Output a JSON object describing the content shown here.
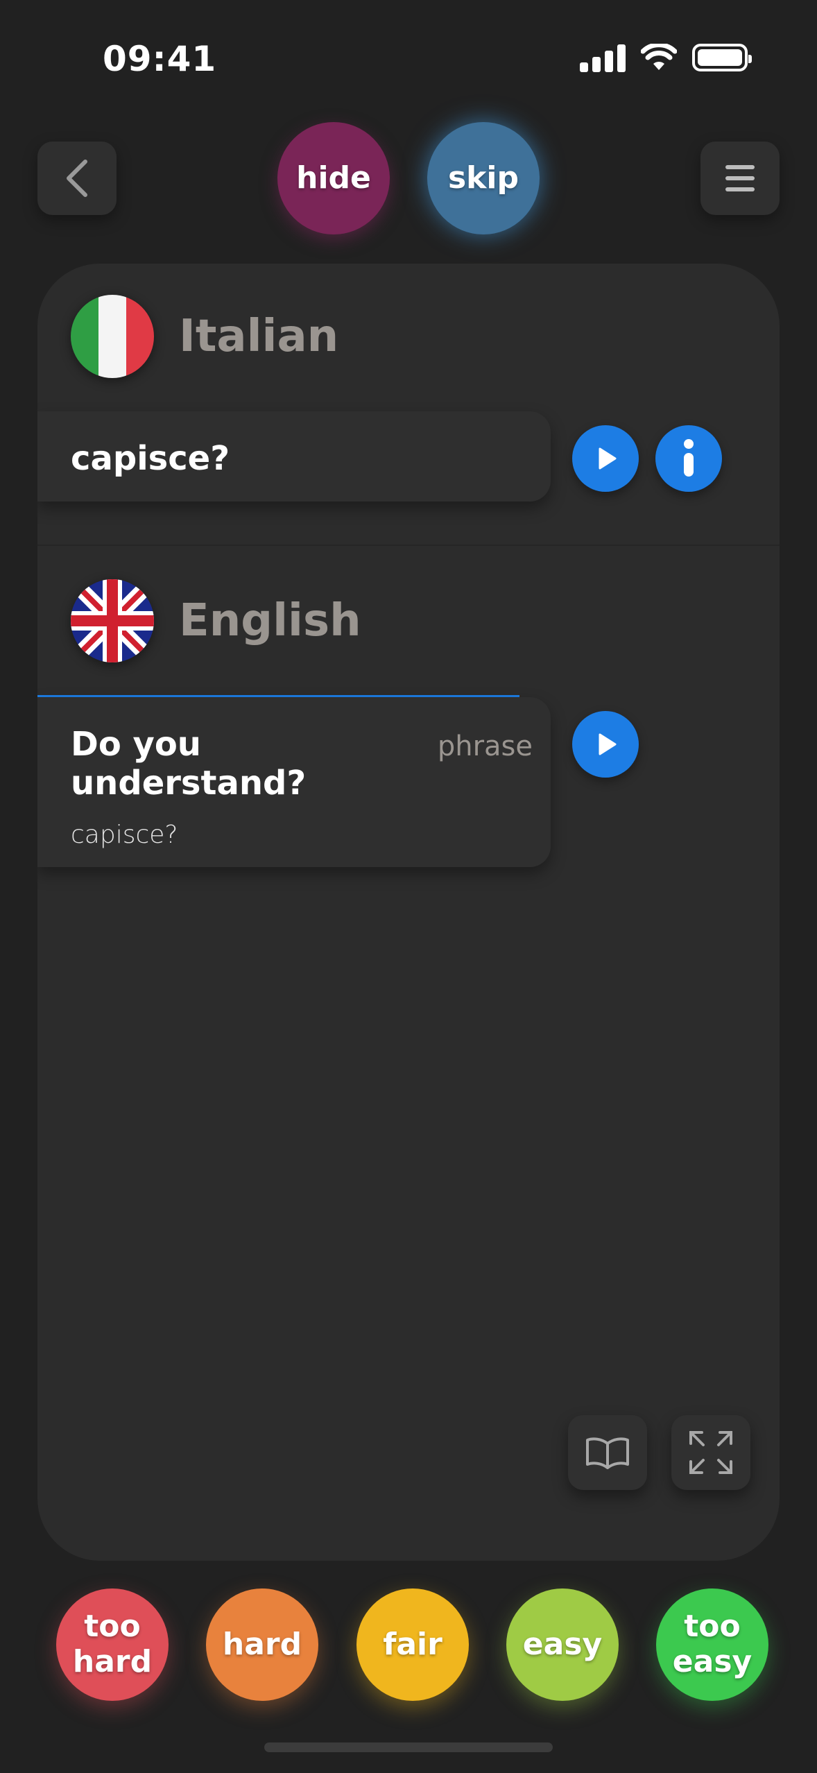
{
  "status_bar": {
    "time": "09:41"
  },
  "top_bar": {
    "hide_label": "hide",
    "skip_label": "skip"
  },
  "source": {
    "language": "Italian",
    "phrase": "capisce?"
  },
  "target": {
    "language": "English",
    "phrase": "Do you understand?",
    "tag": "phrase",
    "subtitle": "capisce?"
  },
  "rating": {
    "too_hard_line1": "too",
    "too_hard_line2": "hard",
    "hard": "hard",
    "fair": "fair",
    "easy": "easy",
    "too_easy_line1": "too",
    "too_easy_line2": "easy"
  },
  "colors": {
    "background": "#212121",
    "card": "#2c2c2c",
    "accent_blue": "#1d7de4",
    "hide": "#7a2557",
    "skip": "#3f7199",
    "too_hard": "#df4f58",
    "hard": "#e8823d",
    "fair": "#f0b61e",
    "easy": "#9fcb45",
    "too_easy": "#3cc94f"
  },
  "icons": {
    "back": "chevron-left-icon",
    "menu": "hamburger-icon",
    "play": "play-icon",
    "info": "info-icon",
    "book": "book-icon",
    "expand": "expand-icon",
    "italy_flag": "italy-flag-icon",
    "uk_flag": "uk-flag-icon"
  }
}
